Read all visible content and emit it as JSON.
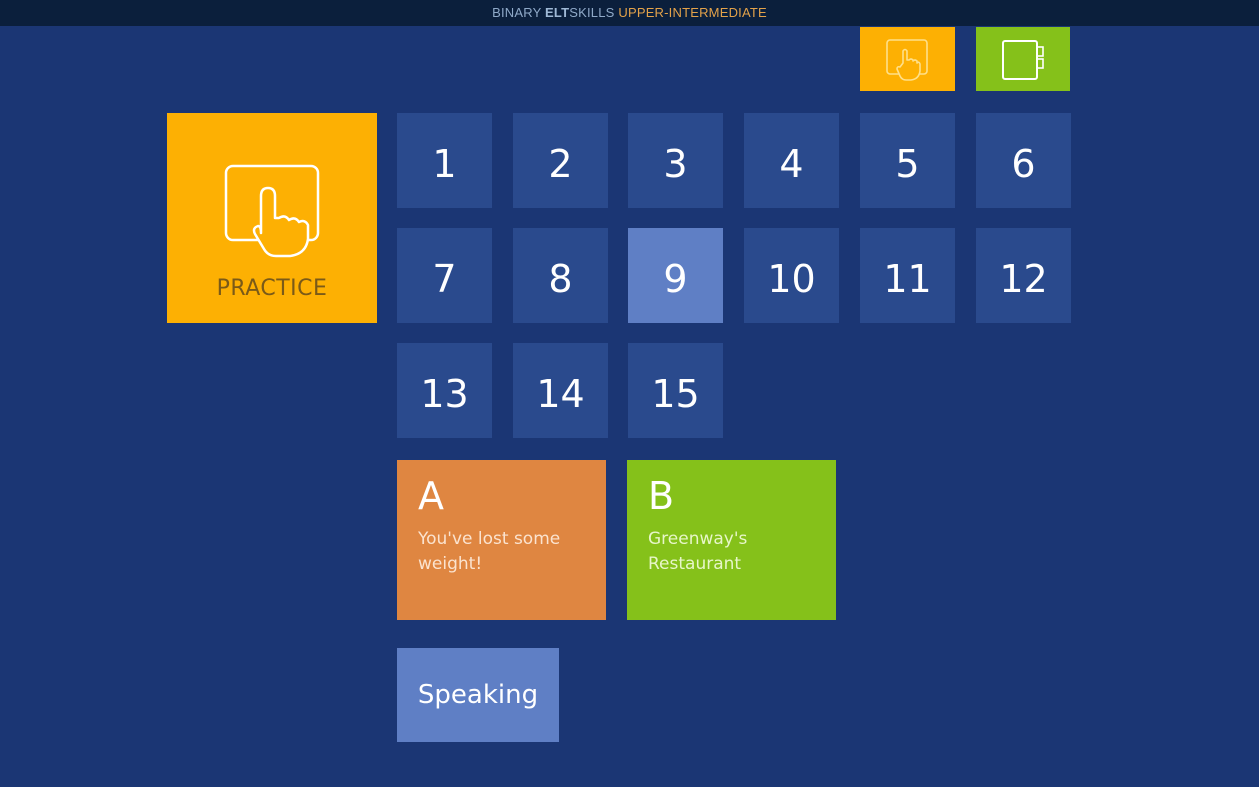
{
  "header": {
    "brand_part1": "BINARY ",
    "brand_part2": "ELT",
    "brand_part3": "SKILLS ",
    "level": "UPPER-INTERMEDIATE"
  },
  "toolbar": {
    "practice_icon": "touch-hand-icon",
    "notebook_icon": "notebook-icon"
  },
  "practice_tile": {
    "label": "PRACTICE",
    "icon": "touch-hand-icon"
  },
  "units": {
    "items": [
      {
        "label": "1"
      },
      {
        "label": "2"
      },
      {
        "label": "3"
      },
      {
        "label": "4"
      },
      {
        "label": "5"
      },
      {
        "label": "6"
      },
      {
        "label": "7"
      },
      {
        "label": "8"
      },
      {
        "label": "9"
      },
      {
        "label": "10"
      },
      {
        "label": "11"
      },
      {
        "label": "12"
      },
      {
        "label": "13"
      },
      {
        "label": "14"
      },
      {
        "label": "15"
      }
    ],
    "selected": "9"
  },
  "sections": {
    "a": {
      "letter": "A",
      "title": "You've lost some weight!"
    },
    "b": {
      "letter": "B",
      "title": "Greenway's Restaurant"
    }
  },
  "speaking": {
    "label": "Speaking"
  },
  "colors": {
    "background": "#1b3674",
    "tile": "#2a4a8d",
    "selected_tile": "#5f7fc5",
    "orange": "#fdb003",
    "green": "#85c11a",
    "card_a": "#df8641"
  }
}
